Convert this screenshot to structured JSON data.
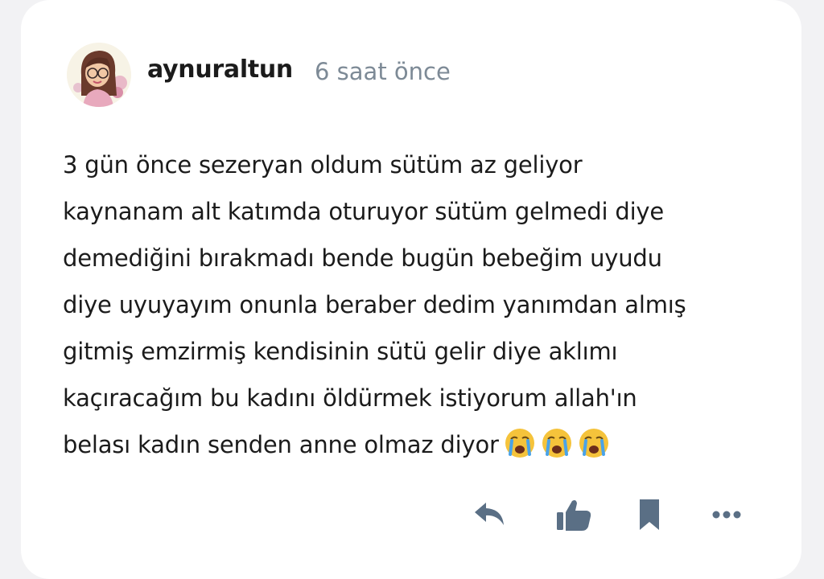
{
  "post": {
    "author": "aynuraltun",
    "time": "6 saat önce",
    "lines": [
      "3 gün önce sezeryan oldum sütüm az geliyor",
      "kaynanam alt katımda oturuyor sütüm gelmedi diye",
      "demediğini bırakmadı bende bugün bebeğim uyudu",
      "diye uyuyayım onunla beraber dedim yanımdan almış",
      "gitmiş emzirmiş kendisinin sütü gelir diye aklımı",
      "kaçıracağım bu kadını öldürmek istiyorum allah'ın",
      "belası kadın senden anne olmaz diyor"
    ],
    "emojis": [
      "crying-face-emoji",
      "crying-face-emoji",
      "crying-face-emoji"
    ]
  },
  "actions": {
    "icons": [
      "reply-icon",
      "thumbs-up-icon",
      "bookmark-icon",
      "more-icon"
    ],
    "icon_color": "#5a6f85"
  }
}
